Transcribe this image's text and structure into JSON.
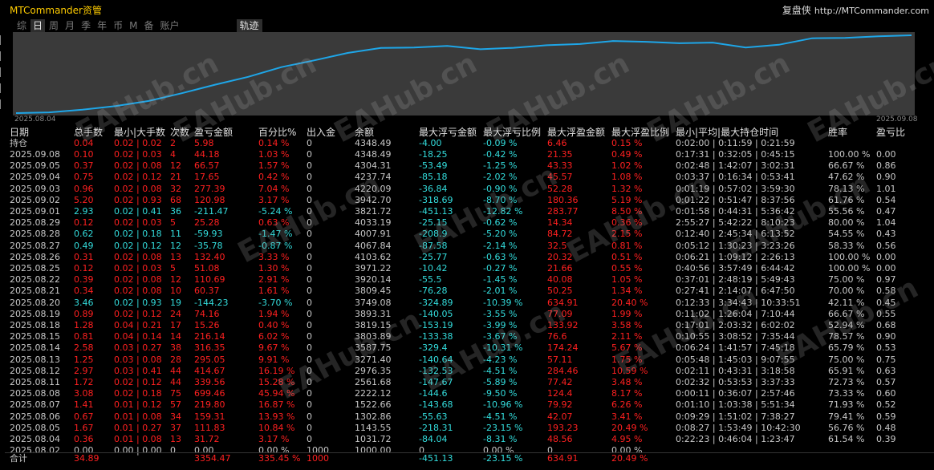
{
  "window": {
    "title": "MTCommander资管",
    "brand": "复盘侠",
    "url": "http://MTCommander.com"
  },
  "tabs": [
    {
      "label": "综",
      "active": false
    },
    {
      "label": "日",
      "active": true
    },
    {
      "label": "周",
      "active": false
    },
    {
      "label": "月",
      "active": false
    },
    {
      "label": "季",
      "active": false
    },
    {
      "label": "年",
      "active": false
    },
    {
      "label": "币",
      "active": false
    },
    {
      "label": "M",
      "active": false
    },
    {
      "label": "备",
      "active": false
    },
    {
      "label": "账户",
      "active": false
    }
  ],
  "track_tab": "轨迹",
  "curve": {
    "start_date": "2025.08.04",
    "end_date": "2025.09.08",
    "color": "#1ea6e8",
    "bg": "#3a3a3a",
    "values": [
      1000,
      1031.72,
      1143.55,
      1302.86,
      1522.66,
      1856,
      2222.12,
      2561.68,
      2976.35,
      3271.4,
      3587.75,
      3803.89,
      3819.15,
      3893.31,
      3749.08,
      3809.45,
      3920.14,
      3971.22,
      4103.62,
      4067.84,
      4007.91,
      4033.19,
      3821.72,
      3942.7,
      4220.09,
      4237.74,
      4304.31,
      4348.49
    ]
  },
  "watermark": "EAHub.cn",
  "table": {
    "headers": [
      "日期",
      "总手数",
      "最小|大手数",
      "次数",
      "盈亏金额",
      "百分比%",
      "出入金",
      "余额",
      "最大浮亏金额",
      "最大浮亏比例",
      "最大浮盈金额",
      "最大浮盈比例",
      "最小|平均|最大持仓时间",
      "胜率",
      "盈亏比"
    ],
    "rows": [
      {
        "c": [
          "持仓",
          "0.04",
          "0.02 | 0.02",
          "2",
          "5.98",
          "0.14 %",
          "0",
          "4348.49",
          "-4.00",
          "-0.09 %",
          "6.46",
          "0.15 %",
          "0:02:00 | 0:11:59 | 0:21:59",
          "",
          ""
        ],
        "t": "r"
      },
      {
        "c": [
          "2025.09.08",
          "0.10",
          "0.02 | 0.03",
          "4",
          "44.18",
          "1.03 %",
          "0",
          "4348.49",
          "-18.25",
          "-0.42 %",
          "21.35",
          "0.49 %",
          "0:17:31 | 0:32:05 | 0:45:15",
          "100.00 %",
          "0.00"
        ],
        "t": "r"
      },
      {
        "c": [
          "2025.09.05",
          "0.37",
          "0.02 | 0.08",
          "12",
          "66.57",
          "1.57 %",
          "0",
          "4304.31",
          "-53.49",
          "-1.25 %",
          "43.33",
          "1.02 %",
          "0:02:48 | 1:42:07 | 3:02:31",
          "66.67 %",
          "0.86"
        ],
        "t": "r"
      },
      {
        "c": [
          "2025.09.04",
          "0.75",
          "0.02 | 0.12",
          "21",
          "17.65",
          "0.42 %",
          "0",
          "4237.74",
          "-85.18",
          "-2.02 %",
          "45.57",
          "1.08 %",
          "0:03:37 | 0:16:34 | 0:53:41",
          "47.62 %",
          "0.90"
        ],
        "t": "r"
      },
      {
        "c": [
          "2025.09.03",
          "0.96",
          "0.02 | 0.08",
          "32",
          "277.39",
          "7.04 %",
          "0",
          "4220.09",
          "-36.84",
          "-0.90 %",
          "52.28",
          "1.32 %",
          "0:01:19 | 0:57:02 | 3:59:30",
          "78.13 %",
          "1.01"
        ],
        "t": "r"
      },
      {
        "c": [
          "2025.09.02",
          "5.20",
          "0.02 | 0.93",
          "68",
          "120.98",
          "3.17 %",
          "0",
          "3942.70",
          "-318.69",
          "-8.70 %",
          "180.36",
          "5.19 %",
          "0:01:22 | 0:51:47 | 8:37:56",
          "61.76 %",
          "0.54"
        ],
        "t": "r"
      },
      {
        "c": [
          "2025.09.01",
          "2.93",
          "0.02 | 0.41",
          "36",
          "-211.47",
          "-5.24 %",
          "0",
          "3821.72",
          "-451.13",
          "-12.82 %",
          "283.77",
          "8.50 %",
          "0:01:58 | 0:44:31 | 5:36:42",
          "55.56 %",
          "0.47"
        ],
        "t": "g"
      },
      {
        "c": [
          "2025.08.29",
          "0.12",
          "0.02 | 0.03",
          "5",
          "25.28",
          "0.63 %",
          "0",
          "4033.19",
          "-25.15",
          "-0.62 %",
          "14.34",
          "0.36 %",
          "2:55:27 | 5:42:22 | 8:10:23",
          "80.00 %",
          "1.04"
        ],
        "t": "r"
      },
      {
        "c": [
          "2025.08.28",
          "0.62",
          "0.02 | 0.18",
          "11",
          "-59.93",
          "-1.47 %",
          "0",
          "4007.91",
          "-208.9",
          "-5.20 %",
          "84.72",
          "2.15 %",
          "0:12:40 | 2:45:34 | 6:13:52",
          "54.55 %",
          "0.43"
        ],
        "t": "g"
      },
      {
        "c": [
          "2025.08.27",
          "0.49",
          "0.02 | 0.12",
          "12",
          "-35.78",
          "-0.87 %",
          "0",
          "4067.84",
          "-87.58",
          "-2.14 %",
          "32.5",
          "0.81 %",
          "0:05:12 | 1:30:23 | 3:23:26",
          "58.33 %",
          "0.56"
        ],
        "t": "g"
      },
      {
        "c": [
          "2025.08.26",
          "0.31",
          "0.02 | 0.08",
          "13",
          "132.40",
          "3.33 %",
          "0",
          "4103.62",
          "-25.77",
          "-0.63 %",
          "20.32",
          "0.51 %",
          "0:06:21 | 1:09:12 | 2:26:13",
          "100.00 %",
          "0.00"
        ],
        "t": "r"
      },
      {
        "c": [
          "2025.08.25",
          "0.12",
          "0.02 | 0.03",
          "5",
          "51.08",
          "1.30 %",
          "0",
          "3971.22",
          "-10.42",
          "-0.27 %",
          "21.66",
          "0.55 %",
          "0:40:56 | 3:57:49 | 6:44:42",
          "100.00 %",
          "0.00"
        ],
        "t": "r"
      },
      {
        "c": [
          "2025.08.22",
          "0.39",
          "0.02 | 0.08",
          "12",
          "110.69",
          "2.91 %",
          "0",
          "3920.14",
          "-55.5",
          "-1.45 %",
          "40.08",
          "1.05 %",
          "0:37:01 | 2:48:19 | 5:49:43",
          "75.00 %",
          "0.97"
        ],
        "t": "r"
      },
      {
        "c": [
          "2025.08.21",
          "0.34",
          "0.02 | 0.08",
          "10",
          "60.37",
          "1.61 %",
          "0",
          "3809.45",
          "-76.28",
          "-2.01 %",
          "50.25",
          "1.34 %",
          "0:27:41 | 2:14:07 | 6:47:50",
          "70.00 %",
          "0.58"
        ],
        "t": "r"
      },
      {
        "c": [
          "2025.08.20",
          "3.46",
          "0.02 | 0.93",
          "19",
          "-144.23",
          "-3.70 %",
          "0",
          "3749.08",
          "-324.89",
          "-10.39 %",
          "634.91",
          "20.40 %",
          "0:12:33 | 3:34:43 | 10:33:51",
          "42.11 %",
          "0.45"
        ],
        "t": "g"
      },
      {
        "c": [
          "2025.08.19",
          "0.89",
          "0.02 | 0.12",
          "24",
          "74.16",
          "1.94 %",
          "0",
          "3893.31",
          "-140.05",
          "-3.55 %",
          "77.09",
          "1.99 %",
          "0:11:02 | 1:26:04 | 7:10:44",
          "66.67 %",
          "0.55"
        ],
        "t": "r"
      },
      {
        "c": [
          "2025.08.18",
          "1.28",
          "0.04 | 0.21",
          "17",
          "15.26",
          "0.40 %",
          "0",
          "3819.15",
          "-153.19",
          "-3.99 %",
          "133.92",
          "3.58 %",
          "0:17:01 | 2:03:32 | 6:02:02",
          "52.94 %",
          "0.68"
        ],
        "t": "r"
      },
      {
        "c": [
          "2025.08.15",
          "0.81",
          "0.04 | 0.14",
          "14",
          "216.14",
          "6.02 %",
          "0",
          "3803.89",
          "-133.38",
          "-3.67 %",
          "76.6",
          "2.11 %",
          "0:10:55 | 3:08:52 | 7:35:44",
          "78.57 %",
          "0.90"
        ],
        "t": "r"
      },
      {
        "c": [
          "2025.08.14",
          "2.58",
          "0.03 | 0.27",
          "38",
          "316.35",
          "9.67 %",
          "0",
          "3587.75",
          "-329.4",
          "-10.31 %",
          "174.24",
          "5.67 %",
          "0:06:24 | 1:41:57 | 7:45:18",
          "65.79 %",
          "0.53"
        ],
        "t": "r"
      },
      {
        "c": [
          "2025.08.13",
          "1.25",
          "0.03 | 0.08",
          "28",
          "295.05",
          "9.91 %",
          "0",
          "3271.40",
          "-140.64",
          "-4.23 %",
          "57.11",
          "1.75 %",
          "0:05:48 | 1:45:03 | 9:07:55",
          "75.00 %",
          "0.75"
        ],
        "t": "r"
      },
      {
        "c": [
          "2025.08.12",
          "2.97",
          "0.03 | 0.41",
          "44",
          "414.67",
          "16.19 %",
          "0",
          "2976.35",
          "-132.53",
          "-4.51 %",
          "284.46",
          "10.59 %",
          "0:02:11 | 0:43:31 | 3:18:58",
          "65.91 %",
          "0.63"
        ],
        "t": "r"
      },
      {
        "c": [
          "2025.08.11",
          "1.72",
          "0.02 | 0.12",
          "44",
          "339.56",
          "15.28 %",
          "0",
          "2561.68",
          "-147.67",
          "-5.89 %",
          "77.42",
          "3.48 %",
          "0:02:32 | 0:53:53 | 3:37:33",
          "72.73 %",
          "0.57"
        ],
        "t": "r"
      },
      {
        "c": [
          "2025.08.08",
          "3.08",
          "0.02 | 0.18",
          "75",
          "699.46",
          "45.94 %",
          "0",
          "2222.12",
          "-144.6",
          "-9.50 %",
          "124.4",
          "8.17 %",
          "0:00:11 | 0:36:07 | 2:57:46",
          "73.33 %",
          "0.60"
        ],
        "t": "r"
      },
      {
        "c": [
          "2025.08.07",
          "1.41",
          "0.01 | 0.12",
          "57",
          "219.80",
          "16.87 %",
          "0",
          "1522.66",
          "-143.68",
          "-10.96 %",
          "79.92",
          "6.26 %",
          "0:01:10 | 1:03:38 | 5:51:34",
          "71.93 %",
          "0.52"
        ],
        "t": "r"
      },
      {
        "c": [
          "2025.08.06",
          "0.67",
          "0.01 | 0.08",
          "34",
          "159.31",
          "13.93 %",
          "0",
          "1302.86",
          "-55.63",
          "-4.51 %",
          "42.07",
          "3.41 %",
          "0:09:29 | 1:51:02 | 7:38:27",
          "79.41 %",
          "0.59"
        ],
        "t": "r"
      },
      {
        "c": [
          "2025.08.05",
          "1.67",
          "0.01 | 0.27",
          "37",
          "111.83",
          "10.84 %",
          "0",
          "1143.55",
          "-218.31",
          "-23.15 %",
          "193.23",
          "20.49 %",
          "0:08:27 | 1:53:49 | 10:42:30",
          "56.76 %",
          "0.48"
        ],
        "t": "r"
      },
      {
        "c": [
          "2025.08.04",
          "0.36",
          "0.01 | 0.08",
          "13",
          "31.72",
          "3.17 %",
          "0",
          "1031.72",
          "-84.04",
          "-8.31 %",
          "48.56",
          "4.95 %",
          "0:22:23 | 0:46:04 | 1:23:47",
          "61.54 %",
          "0.39"
        ],
        "t": "r"
      },
      {
        "c": [
          "2025.08.02",
          "0.00",
          "0.00 | 0.00",
          "0",
          "0.00",
          "0.00 %",
          "1000",
          "1000.00",
          "0",
          "0.00 %",
          "0",
          "0.00 %",
          "",
          "",
          ""
        ],
        "t": "z"
      },
      {
        "c": [
          "合计",
          "34.89",
          "",
          "",
          "3354.47",
          "335.45 %",
          "1000",
          "",
          "-451.13",
          "-23.15 %",
          "634.91",
          "20.49 %",
          "",
          "",
          ""
        ],
        "t": "s"
      }
    ]
  }
}
